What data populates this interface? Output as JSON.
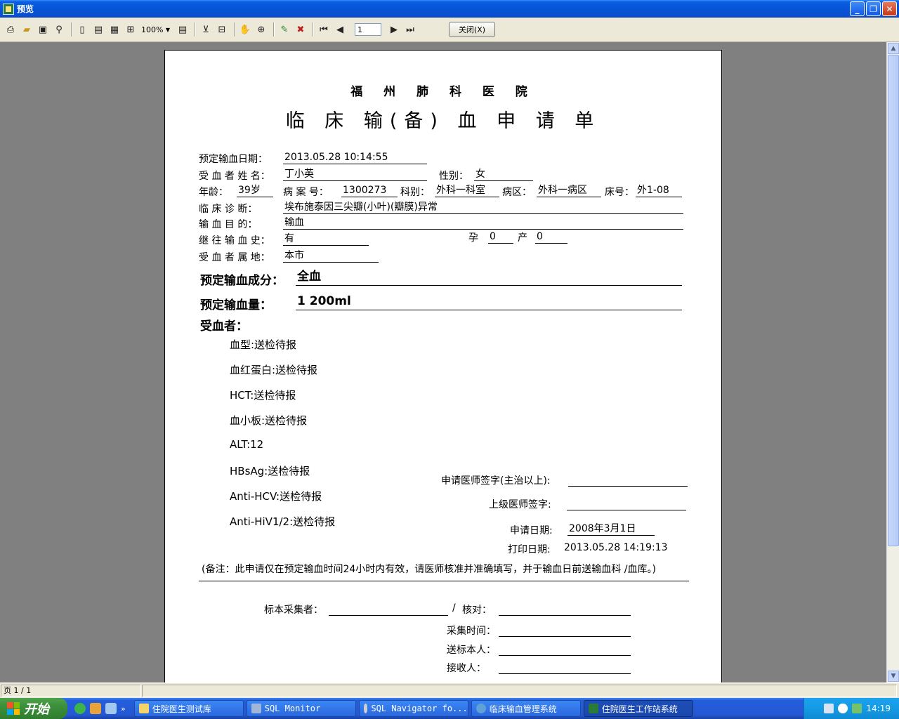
{
  "window": {
    "title": "预览"
  },
  "toolbar": {
    "zoom": "100%",
    "page_current": "1",
    "close_label": "关闭(X)",
    "icons": [
      "print-icon",
      "open-icon",
      "save-icon",
      "find-icon",
      "single-page-icon",
      "two-page-icon",
      "four-page-icon",
      "multi-page-icon",
      "page-width-icon",
      "margins-icon",
      "options-icon",
      "hand-icon",
      "zoom-icon",
      "edit-icon",
      "clear-icon",
      "first-page-icon",
      "prev-page-icon",
      "next-page-icon",
      "last-page-icon"
    ]
  },
  "doc": {
    "hospital": "福 州 肺 科 医 院",
    "title": "临 床 输(备) 血 申 请 单",
    "fields": {
      "date_label": "预定输血日期：",
      "date_value": "2013.05.28 10:14:55",
      "name_label": "受 血 者 姓 名：",
      "name_value": "丁小英",
      "gender_label": "性别：",
      "gender_value": "女",
      "age_label": "年龄：",
      "age_value": "39岁",
      "case_label": "病 案 号：",
      "case_value": "1300273",
      "dept_label": "科别：",
      "dept_value": "外科一科室",
      "ward_label": "病区：",
      "ward_value": "外科一病区",
      "bed_label": "床号：",
      "bed_value": "外1-08",
      "diag_label": "临 床 诊 断：",
      "diag_value": "埃布施泰因三尖瓣(小叶)(瓣膜)异常",
      "purpose_label": "输 血 目 的：",
      "purpose_value": "输血",
      "history_label": "继 往 输 血 史：",
      "history_value": "有",
      "pregnancy_label": "孕",
      "pregnancy_value": "0",
      "birth_label": "产",
      "birth_value": "0",
      "address_label": "受 血 者 属 地：",
      "address_value": "本市",
      "component_label": "预定输血成分：",
      "component_value": "全血",
      "amount_label": "预定输血量：",
      "amount_value": "1 200ml",
      "recipient_label": "受血者："
    },
    "tests": [
      "血型:送检待报",
      "血红蛋白:送检待报",
      "HCT:送检待报",
      "血小板:送检待报",
      "ALT:12",
      "HBsAg:送检待报",
      "Anti-HCV:送检待报",
      "Anti-HiV1/2:送检待报"
    ],
    "signatures": {
      "doctor_label": "申请医师签字(主治以上):",
      "senior_label": "上级医师签字:",
      "apply_date_label": "申请日期:",
      "apply_date_value": "2008年3月1日",
      "print_date_label": "打印日期:",
      "print_date_value": "2013.05.28 14:19:13"
    },
    "note": "(备注：此申请仅在预定输血时间24小时内有效，请医师核准并准确填写，并于输血日前送输血科 /血库。)",
    "collection": {
      "collector_label": "标本采集者：",
      "slash": "/",
      "check_label": "核对：",
      "time_label": "采集时间：",
      "sender_label": "送标本人：",
      "receiver_label": "接收人："
    }
  },
  "status": {
    "page": "页 1 / 1"
  },
  "taskbar": {
    "start": "开始",
    "tasks": [
      {
        "label": "住院医生测试库",
        "color": "#f5d56b"
      },
      {
        "label": "SQL Monitor",
        "color": "#9fb6d8"
      },
      {
        "label": "SQL Navigator fo...",
        "color": "#d0d0d0"
      },
      {
        "label": "临床输血管理系统",
        "color": "#5fa0d8"
      },
      {
        "label": "住院医生工作站系统",
        "color": "#2c7a3a"
      }
    ],
    "clock": "14:19"
  }
}
